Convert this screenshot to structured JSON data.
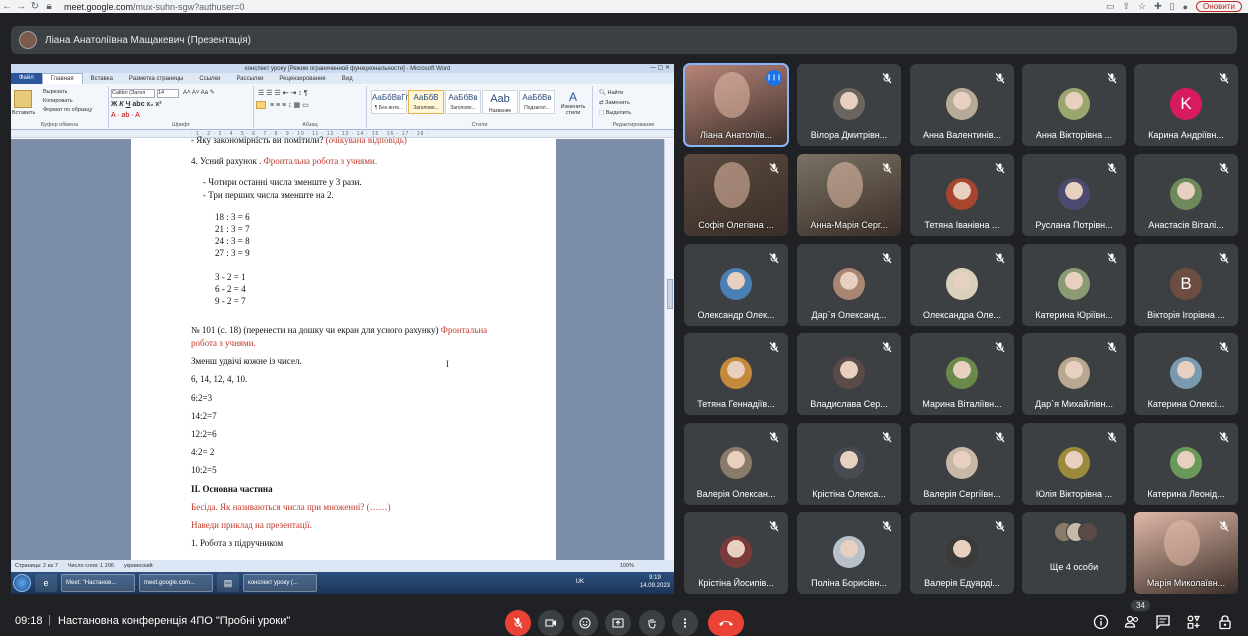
{
  "browser": {
    "url_domain": "meet.google.com",
    "url_path": "/mux-suhn-sgw?authuser=0",
    "update_label": "Оновити"
  },
  "presenter": {
    "label": "Ліана Анатоліївна Мащакевич (Презентація)"
  },
  "word": {
    "title": "конспект уроку  [Режим ограниченной функциональности]  - Microsoft Word",
    "tabs": [
      "Файл",
      "Главная",
      "Вставка",
      "Разметка страницы",
      "Ссылки",
      "Рассылки",
      "Рецензирование",
      "Вид"
    ],
    "active_tab": "Главная",
    "clipboard": {
      "paste": "Вставить",
      "cut": "Вырезать",
      "copy": "Копировать",
      "format": "Формат по образцу",
      "label": "Буфер обмена"
    },
    "font": {
      "name": "Calibri (Загол",
      "size": "14",
      "label": "Шрифт"
    },
    "paragraph_label": "Абзац",
    "styles": [
      {
        "preview": "АаБбВвГг,",
        "name": "¶ Без инте..."
      },
      {
        "preview": "АаБбВ",
        "name": "Заголово..."
      },
      {
        "preview": "АаБбВв",
        "name": "Заголово..."
      },
      {
        "preview": "Aab",
        "name": "Название"
      },
      {
        "preview": "АаБбВв",
        "name": "Подзагол..."
      }
    ],
    "styles_label": "Стили",
    "change_styles": "Изменить стили",
    "editing": {
      "find": "Найти",
      "replace": "Заменить",
      "select": "Выделить",
      "label": "Редактирование"
    },
    "status": {
      "page": "Страница: 2 из 7",
      "words": "Число слов: 1 206",
      "lang": "украинский",
      "zoom": "100%"
    },
    "lines": [
      {
        "text": "- Яку закономірність ви помітили?  ",
        "red": "(очікувана відповідь)"
      },
      {
        "text": "4. Усний рахунок . ",
        "red": "Фронтальна робота з учнями."
      },
      {
        "text": "-    Чотири останні числа зменште у 3  рази."
      },
      {
        "text": "-    Три перших числа зменште на 2."
      },
      {
        "text": "18 : 3 = 6"
      },
      {
        "text": "21 : 3 = 7"
      },
      {
        "text": "24 : 3 = 8"
      },
      {
        "text": "27 : 3 = 9"
      },
      {
        "text": "3 - 2 = 1"
      },
      {
        "text": "6 - 2 = 4"
      },
      {
        "text": "9 - 2 = 7"
      },
      {
        "text": "№ 101 (с. 18) (перенести на дошку чи екран для усного рахунку) ",
        "red": "Фронтальна"
      },
      {
        "red": "робота з учнями."
      },
      {
        "text": "Зменш удвічі кожне із чисел."
      },
      {
        "text": "6, 14, 12, 4, 10."
      },
      {
        "text": "6:2=3"
      },
      {
        "text": "14:2=7"
      },
      {
        "text": "12:2=6"
      },
      {
        "text": "4:2= 2"
      },
      {
        "text": "10:2=5"
      },
      {
        "bold": "ІІ. Основна частина"
      },
      {
        "red": "Бесіда. Як називаються числа при множенні? (……)"
      },
      {
        "red": "Наведи приклад на презентації."
      },
      {
        "text": "1. Робота з підручником"
      }
    ]
  },
  "taskbar": {
    "items": [
      "Meet: \"Настанов...",
      "meet.google.com...",
      "конспект уроку  (..."
    ],
    "lang": "UK",
    "time": "9:19",
    "date": "14.09.2023"
  },
  "participants": [
    {
      "name": "Ліана Анатоліїв...",
      "type": "video",
      "speaking": true,
      "color": "#b9867a"
    },
    {
      "name": "Вілора Дмитрівн...",
      "type": "avatar",
      "color": "#6b6560"
    },
    {
      "name": "Анна Валентинів...",
      "type": "avatar",
      "color": "#b8aa98"
    },
    {
      "name": "Анна Вікторівна ...",
      "type": "avatar",
      "color": "#9aa66e"
    },
    {
      "name": "Карина Андріївн...",
      "type": "letter",
      "letter": "K",
      "color": "#d81b60"
    },
    {
      "name": "Софія Олегівна ...",
      "type": "video",
      "color": "#5b4a3e"
    },
    {
      "name": "Анна-Марія Серг...",
      "type": "video",
      "color": "#7a7264"
    },
    {
      "name": "Тетяна Іванівна ...",
      "type": "avatar",
      "color": "#a8452f"
    },
    {
      "name": "Руслана Потрівн...",
      "type": "avatar",
      "color": "#4c4a6e"
    },
    {
      "name": "Анастасія Віталі...",
      "type": "avatar",
      "color": "#6e8a5a"
    },
    {
      "name": "Олександр Олек...",
      "type": "avatar",
      "color": "#4a7fb5"
    },
    {
      "name": "Дар`я Олександ...",
      "type": "avatar",
      "color": "#a88672"
    },
    {
      "name": "Олександра Оле...",
      "type": "avatar",
      "color": "#d8d0b8"
    },
    {
      "name": "Катерина Юріївн...",
      "type": "avatar",
      "color": "#8a9a72"
    },
    {
      "name": "Вікторія Ігорівна ...",
      "type": "letter",
      "letter": "B",
      "color": "#6d4c41"
    },
    {
      "name": "Тетяна Геннадіїв...",
      "type": "avatar",
      "color": "#c28a3a"
    },
    {
      "name": "Владислава Сер...",
      "type": "avatar",
      "color": "#5a4a48"
    },
    {
      "name": "Марина Віталіївн...",
      "type": "avatar",
      "color": "#6a8a4a"
    },
    {
      "name": "Дар`я Михайлівн...",
      "type": "avatar",
      "color": "#b8a890"
    },
    {
      "name": "Катерина Олексі...",
      "type": "avatar",
      "color": "#7a9ab0"
    },
    {
      "name": "Валерія Олексан...",
      "type": "avatar",
      "color": "#8a7a6a"
    },
    {
      "name": "Крістіна Олекса...",
      "type": "avatar",
      "color": "#4a4a52"
    },
    {
      "name": "Валерія Сергіївн...",
      "type": "avatar",
      "color": "#c8b8a8"
    },
    {
      "name": "Юлія Вікторівна ...",
      "type": "avatar",
      "color": "#9a8a3a"
    },
    {
      "name": "Катерина Леонід...",
      "type": "avatar",
      "color": "#6a9a5a"
    },
    {
      "name": "Крістіна Йосипів...",
      "type": "avatar",
      "color": "#7a3a3a"
    },
    {
      "name": "Поліна Борисівн...",
      "type": "avatar",
      "color": "#b8c0c8"
    },
    {
      "name": "Валерія Едуарді...",
      "type": "avatar",
      "color": "#3a3a3a"
    },
    {
      "name": "Ще 4 особи",
      "type": "group",
      "color": "#8a7a6a"
    },
    {
      "name": "Марія Миколаївн...",
      "type": "video",
      "color": "#e0b8a8"
    }
  ],
  "bottom": {
    "time": "09:18",
    "separator": "|",
    "title": "Настановна конференція 4ПО \"Пробні уроки\"",
    "people_count": "34"
  }
}
